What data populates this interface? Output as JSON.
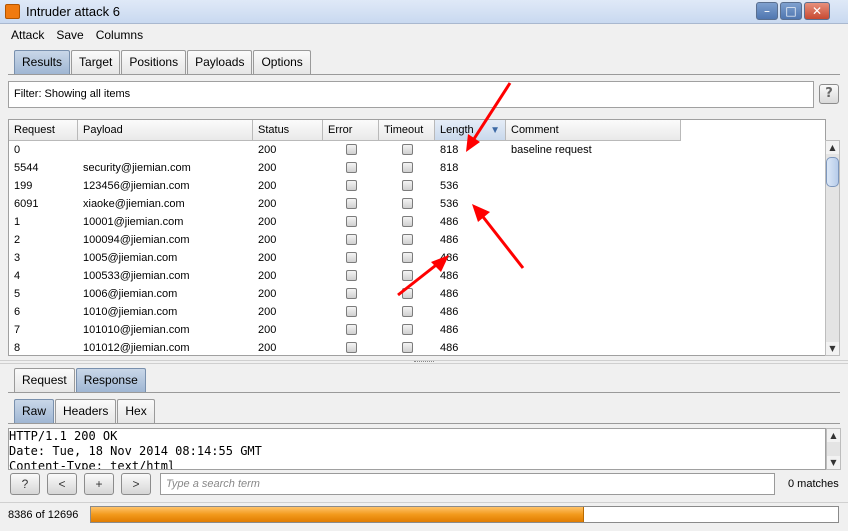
{
  "window": {
    "title": "Intruder attack 6"
  },
  "menu": [
    "Attack",
    "Save",
    "Columns"
  ],
  "main_tabs": [
    {
      "label": "Results",
      "active": true
    },
    {
      "label": "Target"
    },
    {
      "label": "Positions"
    },
    {
      "label": "Payloads"
    },
    {
      "label": "Options"
    }
  ],
  "filter": {
    "text": "Filter:  Showing all items",
    "help": "?"
  },
  "table": {
    "columns": [
      "Request",
      "Payload",
      "Status",
      "Error",
      "Timeout",
      "Length",
      "Comment"
    ],
    "sorted_column": "Length",
    "rows": [
      {
        "request": "0",
        "payload": "",
        "status": "200",
        "length": "818",
        "comment": "baseline request"
      },
      {
        "request": "5544",
        "payload": "security@jiemian.com",
        "status": "200",
        "length": "818",
        "comment": ""
      },
      {
        "request": "199",
        "payload": "123456@jiemian.com",
        "status": "200",
        "length": "536",
        "comment": ""
      },
      {
        "request": "6091",
        "payload": "xiaoke@jiemian.com",
        "status": "200",
        "length": "536",
        "comment": ""
      },
      {
        "request": "1",
        "payload": "10001@jiemian.com",
        "status": "200",
        "length": "486",
        "comment": ""
      },
      {
        "request": "2",
        "payload": "100094@jiemian.com",
        "status": "200",
        "length": "486",
        "comment": ""
      },
      {
        "request": "3",
        "payload": "1005@jiemian.com",
        "status": "200",
        "length": "486",
        "comment": ""
      },
      {
        "request": "4",
        "payload": "100533@jiemian.com",
        "status": "200",
        "length": "486",
        "comment": ""
      },
      {
        "request": "5",
        "payload": "1006@jiemian.com",
        "status": "200",
        "length": "486",
        "comment": ""
      },
      {
        "request": "6",
        "payload": "1010@jiemian.com",
        "status": "200",
        "length": "486",
        "comment": ""
      },
      {
        "request": "7",
        "payload": "101010@jiemian.com",
        "status": "200",
        "length": "486",
        "comment": ""
      },
      {
        "request": "8",
        "payload": "101012@jiemian.com",
        "status": "200",
        "length": "486",
        "comment": ""
      }
    ]
  },
  "detail_tabs": [
    {
      "label": "Request"
    },
    {
      "label": "Response",
      "active": true
    }
  ],
  "view_tabs": [
    {
      "label": "Raw",
      "active": true
    },
    {
      "label": "Headers"
    },
    {
      "label": "Hex"
    }
  ],
  "response_lines": [
    "HTTP/1.1 200 OK",
    "Date: Tue, 18 Nov 2014 08:14:55 GMT",
    "Content-Type: text/html"
  ],
  "search": {
    "buttons": [
      "?",
      "<",
      "+",
      ">"
    ],
    "placeholder": "Type a search term",
    "matches": "0 matches"
  },
  "progress": {
    "text": "8386 of 12696",
    "fraction": 0.6605
  },
  "colors": {
    "accent_orange": "#f29a1c",
    "annotation_red": "#ff0000",
    "selected_tab": "#9fb6d3"
  }
}
